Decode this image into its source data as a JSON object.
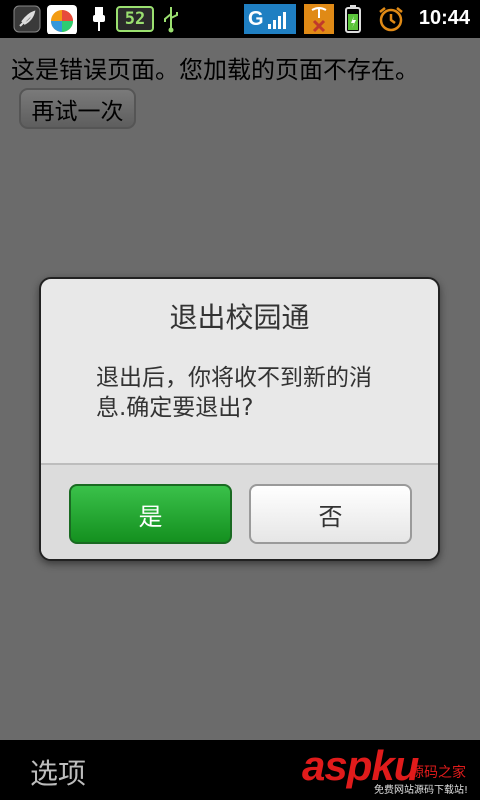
{
  "status_bar": {
    "time": "10:44",
    "notification_badge": "52",
    "network_label": "G"
  },
  "page": {
    "error_message": "这是错误页面。您加载的页面不存在。",
    "retry_label": "再试一次"
  },
  "dialog": {
    "title": "退出校园通",
    "message": "退出后，你将收不到新的消息.确定要退出?",
    "yes_label": "是",
    "no_label": "否"
  },
  "bottom_bar": {
    "options_label": "选项"
  },
  "watermark": {
    "logo": "aspku",
    "site_text": "源码之家",
    "sub_text": "免费网站源码下载站!"
  },
  "colors": {
    "yes_button": "#22a42f",
    "dialog_bg": "#e8e8e8",
    "overlay_bg": "#6b6b6b",
    "watermark_red": "#e01b1b"
  }
}
